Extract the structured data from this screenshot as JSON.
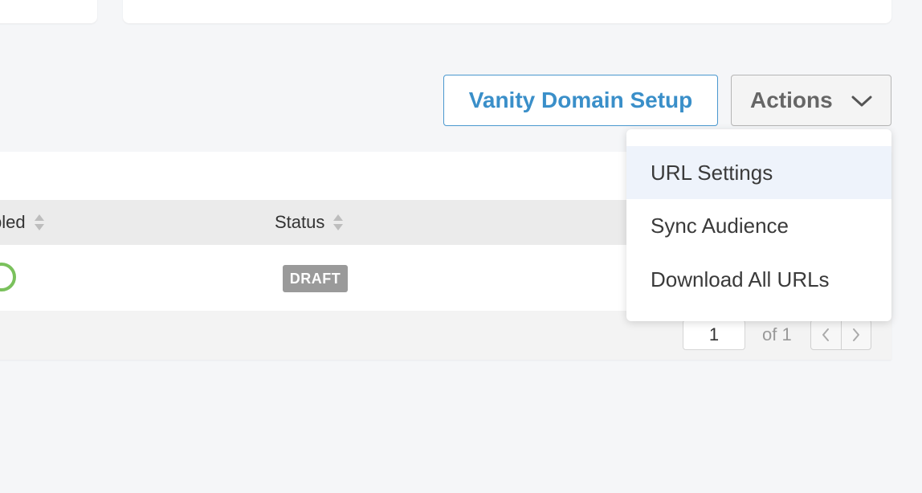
{
  "toolbar": {
    "vanity_label": "Vanity Domain Setup",
    "actions_label": "Actions"
  },
  "table": {
    "columns": [
      {
        "label": "bled"
      },
      {
        "label": "Status"
      }
    ],
    "rows": [
      {
        "enabled": true,
        "status": "DRAFT"
      }
    ]
  },
  "pagination": {
    "current": "1",
    "of_label": "of 1"
  },
  "actions_menu": {
    "items": [
      {
        "label": "URL Settings",
        "highlighted": true
      },
      {
        "label": "Sync Audience",
        "highlighted": false
      },
      {
        "label": "Download All URLs",
        "highlighted": false
      }
    ]
  },
  "colors": {
    "accent": "#3a8fc9",
    "toggle_on": "#7ac15c",
    "draft_badge": "#9a9a9a",
    "menu_highlight": "#eef3fb"
  },
  "icons": {
    "actions_chevron": "chevron-down-icon",
    "sort": "sort-icon",
    "prev": "chevron-left-icon",
    "next": "chevron-right-icon"
  }
}
